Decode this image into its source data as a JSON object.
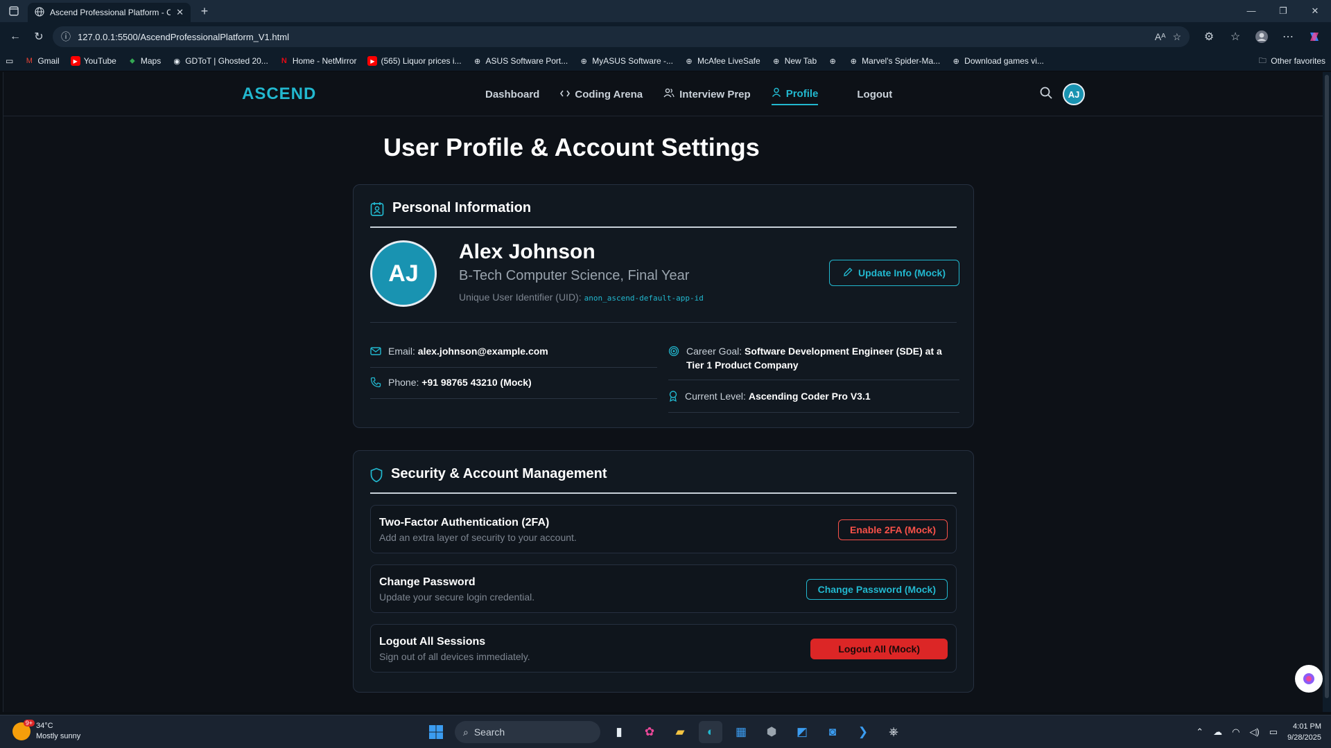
{
  "browser": {
    "tab_title": "Ascend Professional Platform - C",
    "url": "127.0.0.1:5500/AscendProfessionalPlatform_V1.html",
    "bookmarks": [
      "Gmail",
      "YouTube",
      "Maps",
      "GDToT | Ghosted 20...",
      "Home - NetMirror",
      "(565) Liquor prices i...",
      "ASUS Software Port...",
      "MyASUS Software -...",
      "McAfee LiveSafe",
      "New Tab",
      "",
      "Marvel's Spider-Ma...",
      "Download games vi..."
    ],
    "other_favorites": "Other favorites"
  },
  "app": {
    "logo": "ASCEND",
    "nav": [
      "Dashboard",
      "Coding Arena",
      "Interview Prep",
      "Profile",
      "Logout"
    ],
    "active_nav": "Profile",
    "avatar_initials": "AJ",
    "accent_color": "#22b8cf"
  },
  "page": {
    "title": "User Profile & Account Settings"
  },
  "personal": {
    "heading": "Personal Information",
    "initials": "AJ",
    "name": "Alex Johnson",
    "subtitle": "B-Tech Computer Science, Final Year",
    "uid_label": "Unique User Identifier (UID):",
    "uid_value": "anon_ascend-default-app-id",
    "update_button": "Update Info (Mock)",
    "email_label": "Email:",
    "email_value": "alex.johnson@example.com",
    "phone_label": "Phone:",
    "phone_value": "+91 98765 43210 (Mock)",
    "goal_label": "Career Goal:",
    "goal_value": "Software Development Engineer (SDE) at a Tier 1 Product Company",
    "level_label": "Current Level:",
    "level_value": "Ascending Coder Pro V3.1"
  },
  "security": {
    "heading": "Security & Account Management",
    "rows": [
      {
        "title": "Two-Factor Authentication (2FA)",
        "desc": "Add an extra layer of security to your account.",
        "button": "Enable 2FA (Mock)"
      },
      {
        "title": "Change Password",
        "desc": "Update your secure login credential.",
        "button": "Change Password (Mock)"
      },
      {
        "title": "Logout All Sessions",
        "desc": "Sign out of all devices immediately.",
        "button": "Logout All (Mock)"
      }
    ]
  },
  "taskbar": {
    "temp": "34°C",
    "weather": "Mostly sunny",
    "weather_badge": "9+",
    "search_placeholder": "Search",
    "time": "4:01 PM",
    "date": "9/28/2025"
  }
}
